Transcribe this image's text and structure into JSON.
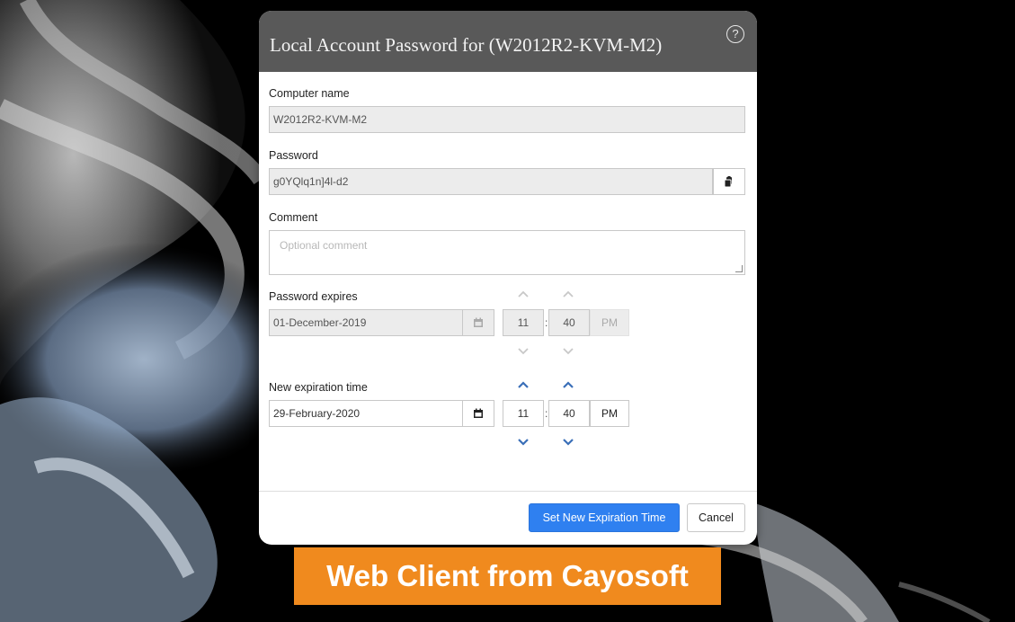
{
  "dialog": {
    "title": "Local Account Password for (W2012R2-KVM-M2)",
    "help_icon": "question-circle-icon",
    "help_glyph": "?"
  },
  "computer": {
    "label": "Computer name",
    "value": "W2012R2-KVM-M2"
  },
  "password": {
    "label": "Password",
    "value": "g0YQlq1n]4l-d2",
    "copy_icon": "copy-clipboard-icon"
  },
  "comment": {
    "label": "Comment",
    "placeholder": "Optional comment"
  },
  "expires": {
    "label": "Password expires",
    "date": "01-December-2019",
    "hour": "11",
    "minute": "40",
    "ampm": "PM",
    "separator": ":",
    "calendar_icon": "calendar-icon"
  },
  "new_expiration": {
    "label": "New expiration time",
    "date": "29-February-2020",
    "hour": "11",
    "minute": "40",
    "ampm": "PM",
    "separator": ":",
    "calendar_icon": "calendar-icon"
  },
  "buttons": {
    "primary": "Set New Expiration Time",
    "cancel": "Cancel"
  },
  "banner": {
    "text": "Web Client from Cayosoft"
  },
  "colors": {
    "header_bg": "#595959",
    "primary": "#2f80f0",
    "banner": "#f08a1e",
    "chevron_active": "#3a6fb8",
    "chevron_disabled": "#c8c8c8"
  }
}
